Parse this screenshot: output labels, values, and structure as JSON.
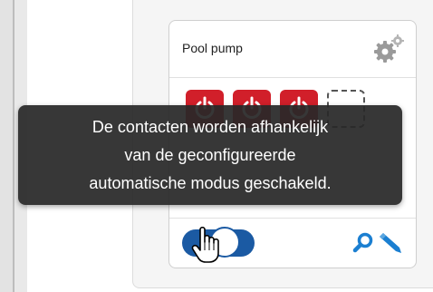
{
  "card": {
    "title": "Pool pump",
    "settings_icon": "gear-icon",
    "contacts": [
      {
        "state": "on",
        "icon": "power-icon"
      },
      {
        "state": "on",
        "icon": "power-icon"
      },
      {
        "state": "on",
        "icon": "power-icon"
      },
      {
        "state": "empty",
        "icon": "empty-slot"
      }
    ],
    "footer": {
      "toggle_state": "on",
      "search_icon": "search-icon",
      "edit_icon": "edit-icon"
    }
  },
  "tooltip": {
    "lines": [
      "De contacten worden afhankelijk",
      "van de geconfigureerde",
      "automatische modus geschakeld."
    ]
  },
  "colors": {
    "accent": "#1b5aa3",
    "contact_on": "#d11f2a",
    "tooltip_bg": "#282828"
  }
}
